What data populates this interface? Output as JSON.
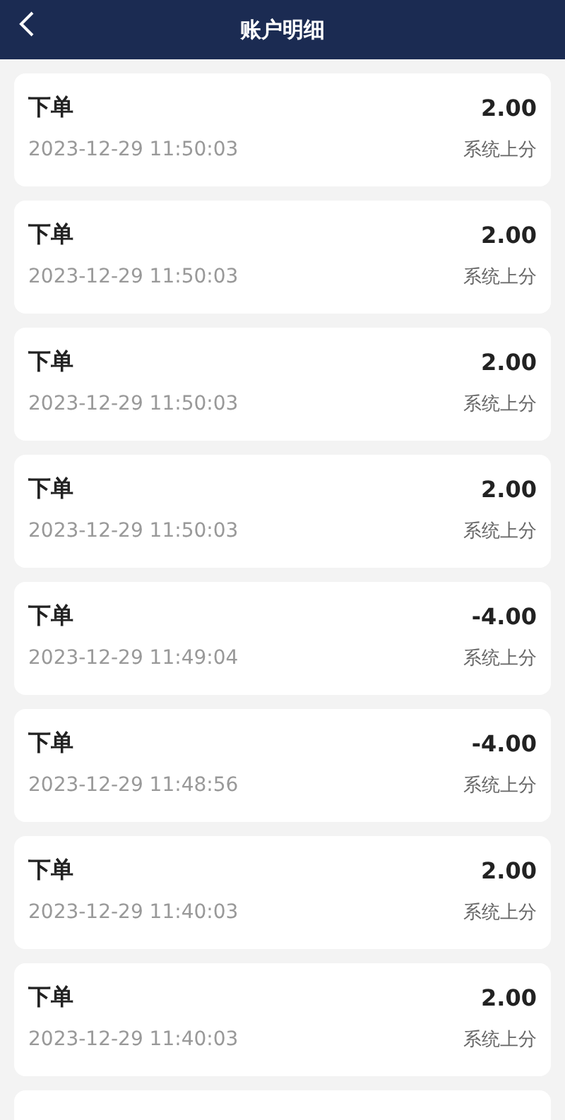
{
  "header": {
    "title": "账户明细"
  },
  "records": [
    {
      "kind": "full",
      "type": "下单",
      "amount": "2.00",
      "time": "2023-12-29 11:50:03",
      "note": "系统上分"
    },
    {
      "kind": "full",
      "type": "下单",
      "amount": "2.00",
      "time": "2023-12-29 11:50:03",
      "note": "系统上分"
    },
    {
      "kind": "full",
      "type": "下单",
      "amount": "2.00",
      "time": "2023-12-29 11:50:03",
      "note": "系统上分"
    },
    {
      "kind": "full",
      "type": "下单",
      "amount": "2.00",
      "time": "2023-12-29 11:50:03",
      "note": "系统上分"
    },
    {
      "kind": "full",
      "type": "下单",
      "amount": "-4.00",
      "time": "2023-12-29 11:49:04",
      "note": "系统上分"
    },
    {
      "kind": "full",
      "type": "下单",
      "amount": "-4.00",
      "time": "2023-12-29 11:48:56",
      "note": "系统上分"
    },
    {
      "kind": "full",
      "type": "下单",
      "amount": "2.00",
      "time": "2023-12-29 11:40:03",
      "note": "系统上分"
    },
    {
      "kind": "full",
      "type": "下单",
      "amount": "2.00",
      "time": "2023-12-29 11:40:03",
      "note": "系统上分"
    },
    {
      "kind": "partial"
    }
  ]
}
